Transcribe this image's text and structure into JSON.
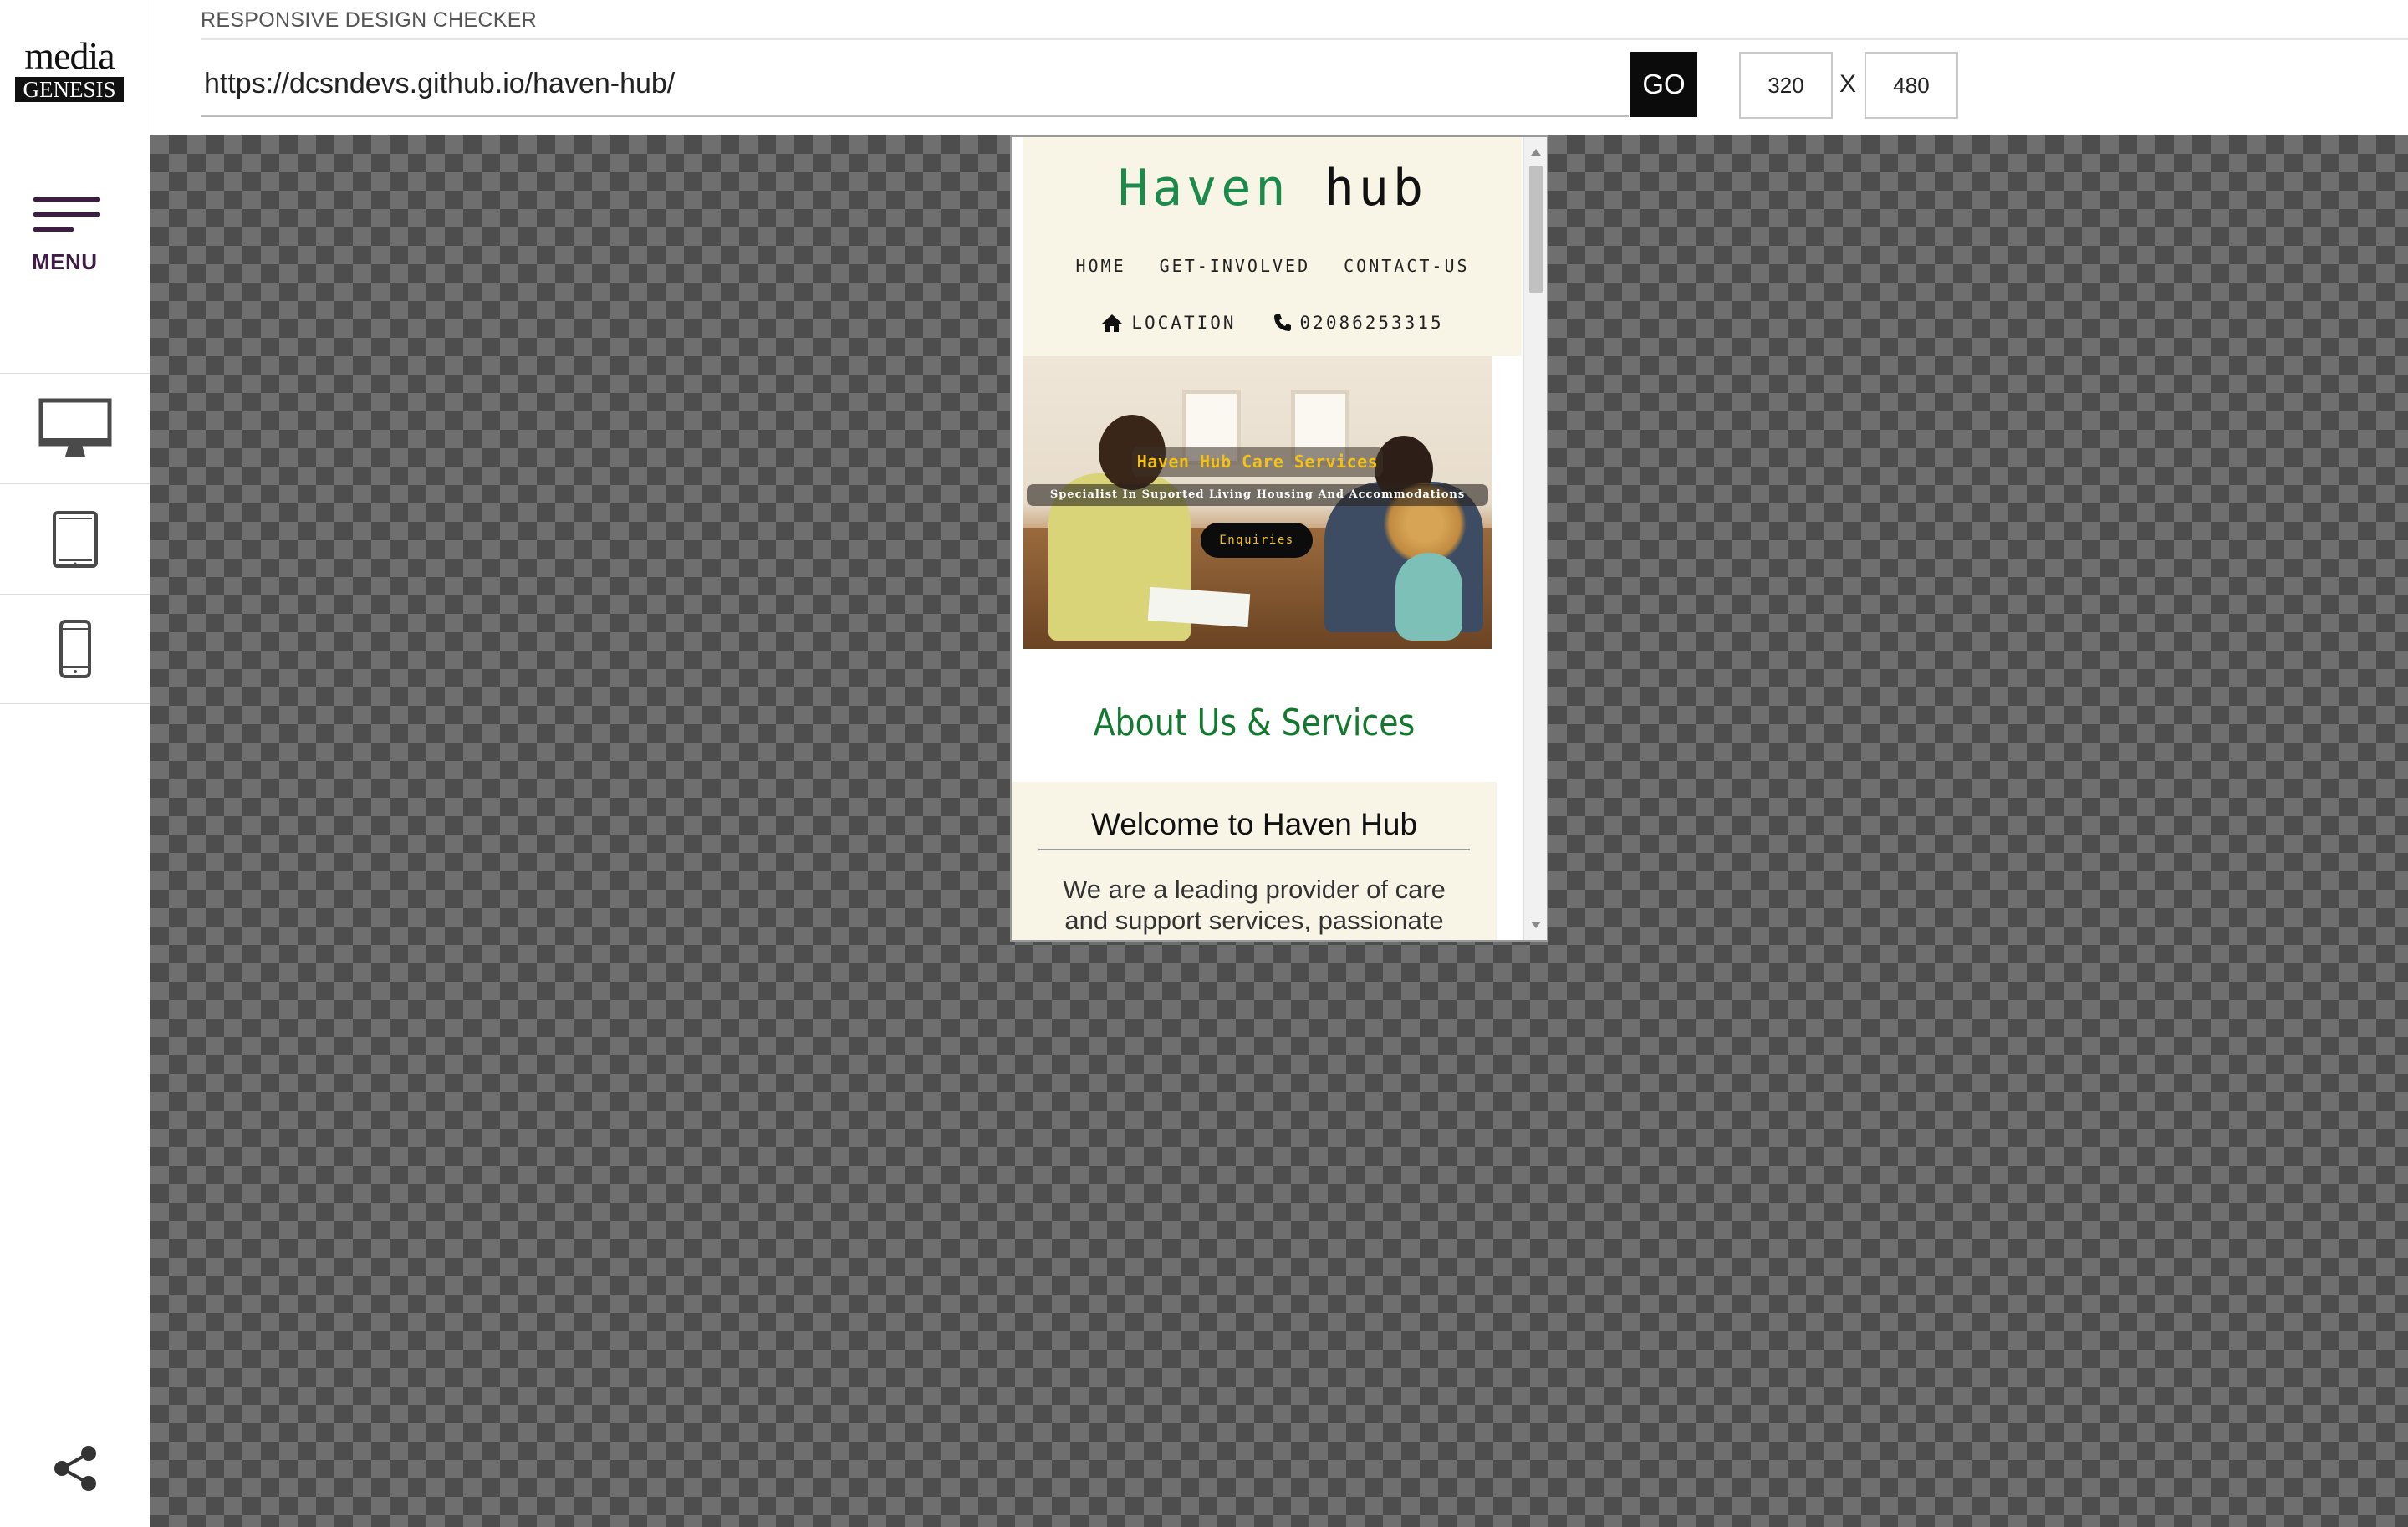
{
  "app": {
    "title": "RESPONSIVE DESIGN CHECKER",
    "logo": {
      "line1": "media",
      "line2": "GENESIS"
    }
  },
  "sidebar": {
    "menu_label": "MENU",
    "devices": [
      {
        "name": "desktop",
        "icon": "desktop-monitor-icon"
      },
      {
        "name": "tablet",
        "icon": "tablet-icon"
      },
      {
        "name": "mobile",
        "icon": "mobile-phone-icon"
      }
    ],
    "share_icon": "share-icon"
  },
  "toolbar": {
    "url_value": "https://dcsndevs.github.io/haven-hub/",
    "go_label": "GO",
    "width_value": "320",
    "height_value": "480",
    "separator": "X"
  },
  "site": {
    "brand_part1": "Haven",
    "brand_part2": "hub",
    "nav": [
      "HOME",
      "GET-INVOLVED",
      "CONTACT-US"
    ],
    "location_label": "LOCATION",
    "phone": "02086253315",
    "hero_title": "Haven Hub Care Services",
    "hero_subtitle": "Specialist In Suported Living Housing And Accommodations",
    "hero_button": "Enquiries",
    "about_title": "About Us & Services",
    "welcome_title": "Welcome to Haven Hub",
    "welcome_text": "We are a leading provider of care and support services, passionate"
  },
  "colors": {
    "brand_green": "#1c8a4b",
    "about_green": "#13792f",
    "menu_purple": "#3d1d43",
    "hero_yellow": "#f2c21a",
    "cream": "#f8f4e6"
  }
}
